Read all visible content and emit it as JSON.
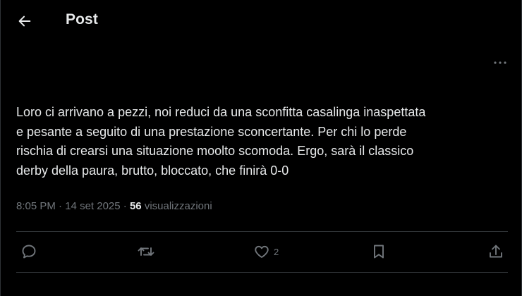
{
  "header": {
    "title": "Post",
    "back_icon": "arrow-left-icon"
  },
  "post": {
    "more_icon": "more-horizontal-icon",
    "text": "Loro ci arrivano a pezzi, noi reduci da una sconfitta casalinga inaspettata\ne pesante a seguito di una prestazione sconcertante. Per chi lo perde\nrischia di crearsi una situazione moolto scomoda. Ergo, sarà il classico\nderby della paura, brutto, bloccato, che finirà 0-0",
    "time": "8:05 PM",
    "separator": "·",
    "date": "14 set 2025",
    "views_count": "56",
    "views_label": "visualizzazioni"
  },
  "actions": {
    "reply_icon": "reply-icon",
    "repost_icon": "repost-icon",
    "like_icon": "heart-icon",
    "like_count": "2",
    "bookmark_icon": "bookmark-icon",
    "share_icon": "share-icon"
  },
  "colors": {
    "background": "#000000",
    "text": "#e7e9ea",
    "secondary": "#71767b",
    "divider": "#2f3336"
  }
}
